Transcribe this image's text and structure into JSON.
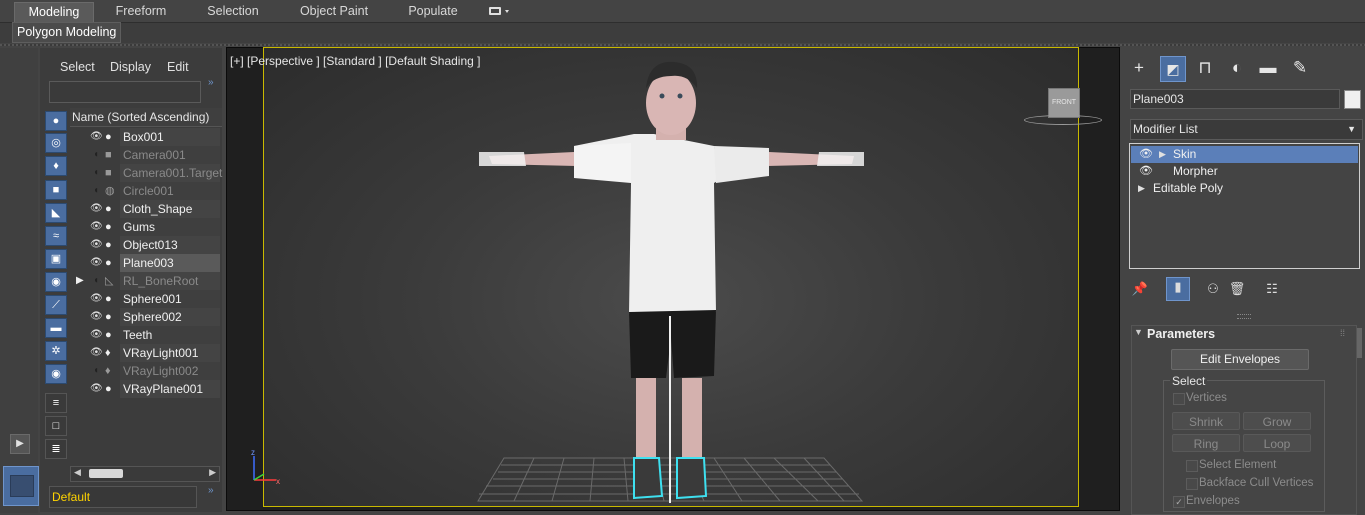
{
  "ribbon": {
    "tabs": [
      "Modeling",
      "Freeform",
      "Selection",
      "Object Paint",
      "Populate"
    ],
    "active_tab": "Modeling",
    "sub_label": "Polygon Modeling"
  },
  "scene_explorer": {
    "menus": [
      "Select",
      "Display",
      "Edit"
    ],
    "column_header": "Name (Sorted Ascending)",
    "items": [
      {
        "name": "Box001",
        "type": "geometry",
        "hidden": false,
        "selected": false
      },
      {
        "name": "Camera001",
        "type": "camera",
        "hidden": true,
        "selected": false
      },
      {
        "name": "Camera001.Target",
        "type": "camera",
        "hidden": true,
        "selected": false
      },
      {
        "name": "Circle001",
        "type": "shape",
        "hidden": true,
        "selected": false
      },
      {
        "name": "Cloth_Shape",
        "type": "geometry",
        "hidden": false,
        "selected": false
      },
      {
        "name": "Gums",
        "type": "geometry",
        "hidden": false,
        "selected": false
      },
      {
        "name": "Object013",
        "type": "geometry",
        "hidden": false,
        "selected": false
      },
      {
        "name": "Plane003",
        "type": "geometry",
        "hidden": false,
        "selected": true
      },
      {
        "name": "RL_BoneRoot",
        "type": "bone",
        "hidden": true,
        "selected": false
      },
      {
        "name": "Sphere001",
        "type": "geometry",
        "hidden": false,
        "selected": false
      },
      {
        "name": "Sphere002",
        "type": "geometry",
        "hidden": false,
        "selected": false
      },
      {
        "name": "Teeth",
        "type": "geometry",
        "hidden": false,
        "selected": false
      },
      {
        "name": "VRayLight001",
        "type": "light",
        "hidden": false,
        "selected": false
      },
      {
        "name": "VRayLight002",
        "type": "light",
        "hidden": true,
        "selected": false
      },
      {
        "name": "VRayPlane001",
        "type": "geometry",
        "hidden": false,
        "selected": false
      }
    ],
    "layer": "Default"
  },
  "viewport": {
    "label": "[+] [Perspective ] [Standard ] [Default Shading ]",
    "viewcube": "FRONT",
    "axis_z": "z",
    "axis_x": "x"
  },
  "command_panel": {
    "object_name": "Plane003",
    "object_color": "#f0f0f0",
    "modifier_list": "Modifier List",
    "stack": [
      {
        "name": "Skin",
        "selected": true,
        "has_eye": true,
        "expandable": true
      },
      {
        "name": "Morpher",
        "selected": false,
        "has_eye": true,
        "expandable": false
      },
      {
        "name": "Editable Poly",
        "selected": false,
        "has_eye": false,
        "expandable": true
      }
    ],
    "parameters": {
      "title": "Parameters",
      "edit_envelopes": "Edit Envelopes",
      "select_group": "Select",
      "vertices": "Vertices",
      "shrink": "Shrink",
      "grow": "Grow",
      "ring": "Ring",
      "loop": "Loop",
      "select_element": "Select Element",
      "backface_cull": "Backface Cull Vertices",
      "envelopes": "Envelopes"
    }
  },
  "colors": {
    "selection_blue": "#5b7fb9",
    "safe_frame": "#c9b900",
    "layer_text": "#ffd400"
  }
}
